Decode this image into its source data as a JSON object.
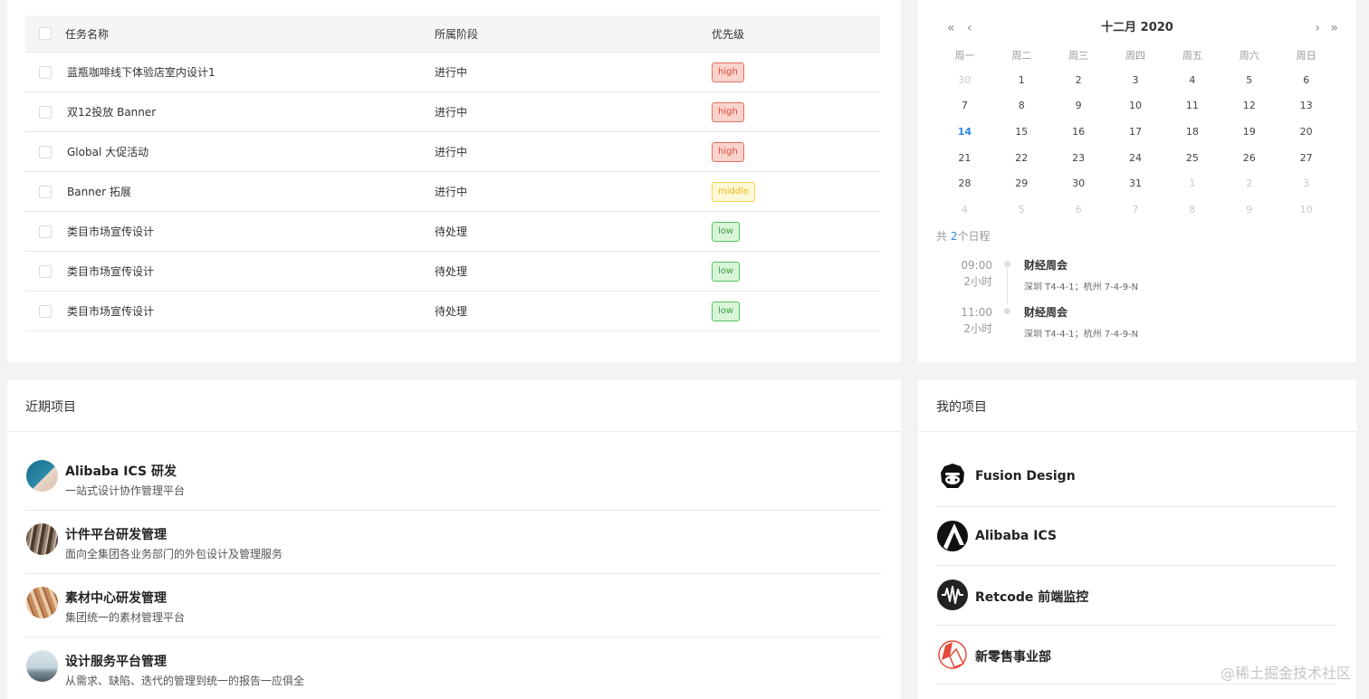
{
  "tasks": {
    "columns": {
      "name": "任务名称",
      "stage": "所属阶段",
      "priority": "优先级"
    },
    "rows": [
      {
        "name": "蓝瓶咖啡线下体验店室内设计1",
        "stage": "进行中",
        "priority": "high"
      },
      {
        "name": "双12投放 Banner",
        "stage": "进行中",
        "priority": "high"
      },
      {
        "name": "Global 大促活动",
        "stage": "进行中",
        "priority": "high"
      },
      {
        "name": "Banner 拓展",
        "stage": "进行中",
        "priority": "middle"
      },
      {
        "name": "类目市场宣传设计",
        "stage": "待处理",
        "priority": "low"
      },
      {
        "name": "类目市场宣传设计",
        "stage": "待处理",
        "priority": "low"
      },
      {
        "name": "类目市场宣传设计",
        "stage": "待处理",
        "priority": "low"
      }
    ]
  },
  "calendar": {
    "title": "十二月  2020",
    "nav": {
      "prev_year": "«",
      "prev_month": "‹",
      "next_month": "›",
      "next_year": "»"
    },
    "weekdays": [
      "周一",
      "周二",
      "周三",
      "周四",
      "周五",
      "周六",
      "周日"
    ],
    "weeks": [
      [
        {
          "d": "30",
          "other": true
        },
        {
          "d": "1"
        },
        {
          "d": "2"
        },
        {
          "d": "3"
        },
        {
          "d": "4"
        },
        {
          "d": "5"
        },
        {
          "d": "6"
        }
      ],
      [
        {
          "d": "7"
        },
        {
          "d": "8"
        },
        {
          "d": "9"
        },
        {
          "d": "10"
        },
        {
          "d": "11"
        },
        {
          "d": "12"
        },
        {
          "d": "13"
        }
      ],
      [
        {
          "d": "14",
          "today": true
        },
        {
          "d": "15"
        },
        {
          "d": "16"
        },
        {
          "d": "17"
        },
        {
          "d": "18"
        },
        {
          "d": "19"
        },
        {
          "d": "20"
        }
      ],
      [
        {
          "d": "21"
        },
        {
          "d": "22"
        },
        {
          "d": "23"
        },
        {
          "d": "24"
        },
        {
          "d": "25"
        },
        {
          "d": "26"
        },
        {
          "d": "27"
        }
      ],
      [
        {
          "d": "28"
        },
        {
          "d": "29"
        },
        {
          "d": "30"
        },
        {
          "d": "31"
        },
        {
          "d": "1",
          "other": true
        },
        {
          "d": "2",
          "other": true
        },
        {
          "d": "3",
          "other": true
        }
      ],
      [
        {
          "d": "4",
          "other": true
        },
        {
          "d": "5",
          "other": true
        },
        {
          "d": "6",
          "other": true
        },
        {
          "d": "7",
          "other": true
        },
        {
          "d": "8",
          "other": true
        },
        {
          "d": "9",
          "other": true
        },
        {
          "d": "10",
          "other": true
        }
      ]
    ],
    "schedule_prefix": "共",
    "schedule_count": "2",
    "schedule_suffix": "个日程",
    "events": [
      {
        "time": "09:00",
        "duration": "2小时",
        "title": "财经周会",
        "location": "深圳 T4-4-1；杭州 7-4-9-N"
      },
      {
        "time": "11:00",
        "duration": "2小时",
        "title": "财经周会",
        "location": "深圳 T4-4-1；杭州 7-4-9-N"
      }
    ]
  },
  "recent": {
    "title": "近期项目",
    "items": [
      {
        "title": "Alibaba ICS 研发",
        "desc": "一站式设计协作管理平台"
      },
      {
        "title": "计件平台研发管理",
        "desc": "面向全集团各业务部门的外包设计及管理服务"
      },
      {
        "title": "素材中心研发管理",
        "desc": "集团统一的素材管理平台"
      },
      {
        "title": "设计服务平台管理",
        "desc": "从需求、缺陷、迭代的管理到统一的报告一应俱全"
      }
    ]
  },
  "mine": {
    "title": "我的项目",
    "items": [
      {
        "label": "Fusion Design",
        "icon": "gorilla-logo-icon"
      },
      {
        "label": "Alibaba ICS",
        "icon": "ics-logo-icon"
      },
      {
        "label": "Retcode 前端监控",
        "icon": "retcode-logo-icon"
      },
      {
        "label": "新零售事业部",
        "icon": "new-retail-logo-icon"
      }
    ]
  },
  "watermark": "@稀土掘金技术社区",
  "colors": {
    "accent": "#2f8ae5",
    "high": "#e46f62",
    "middle": "#f5d553",
    "low": "#56c15f"
  }
}
